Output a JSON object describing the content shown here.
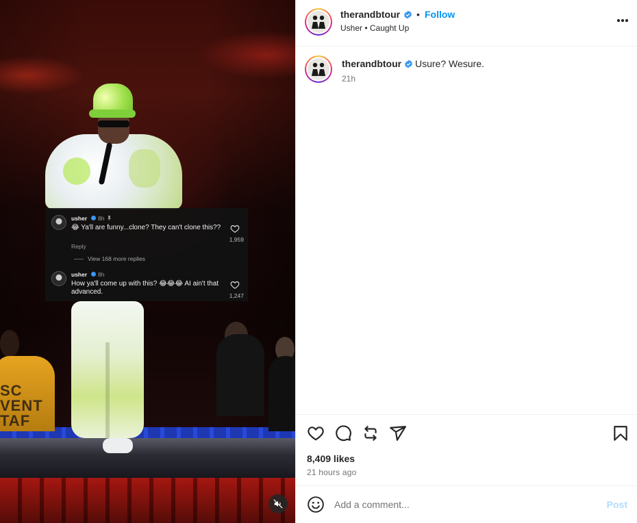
{
  "post": {
    "header": {
      "username": "therandbtour",
      "follow_label": "Follow",
      "subline": "Usher • Caught Up",
      "separator": "•"
    },
    "caption": {
      "username": "therandbtour",
      "text": "Usure? Wesure.",
      "time": "21h"
    },
    "likes": "8,409 likes",
    "time_ago": "21 hours ago",
    "comment_box": {
      "placeholder": "Add a comment...",
      "post_label": "Post"
    }
  },
  "video_overlay": {
    "crowd_text": "SC\nVENT\nTAF",
    "comments": [
      {
        "username": "usher",
        "meta": "8h",
        "text": "😂 Ya'll are funny...clone?  They can't clone this??",
        "likes": "1,959",
        "reply_label": "Reply",
        "view_more": "View 168 more replies"
      },
      {
        "username": "usher",
        "meta": "8h",
        "text": "How ya'll come up with this? 😂😂😂 AI ain't that advanced.",
        "likes": "1,247"
      }
    ]
  },
  "icons": {
    "verified": "verified-badge-icon",
    "more": "more-options-icon",
    "like": "heart-icon",
    "comment": "comment-icon",
    "repost": "repost-icon",
    "share": "share-icon",
    "save": "bookmark-icon",
    "emoji": "emoji-icon",
    "mute": "muted-speaker-icon",
    "pin": "pin-icon"
  },
  "colors": {
    "accent": "#0095f6",
    "verified": "#3897f0",
    "post_disabled": "#b3dbff",
    "muted_text": "#737373"
  }
}
